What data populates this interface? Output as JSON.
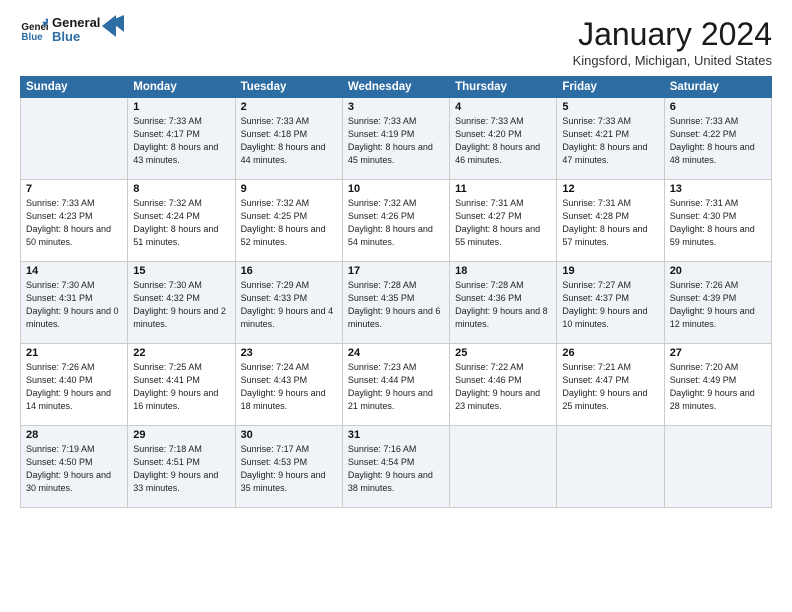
{
  "header": {
    "logo_line1": "General",
    "logo_line2": "Blue",
    "month_title": "January 2024",
    "location": "Kingsford, Michigan, United States"
  },
  "weekdays": [
    "Sunday",
    "Monday",
    "Tuesday",
    "Wednesday",
    "Thursday",
    "Friday",
    "Saturday"
  ],
  "weeks": [
    [
      {
        "day": "",
        "sunrise": "",
        "sunset": "",
        "daylight": ""
      },
      {
        "day": "1",
        "sunrise": "Sunrise: 7:33 AM",
        "sunset": "Sunset: 4:17 PM",
        "daylight": "Daylight: 8 hours and 43 minutes."
      },
      {
        "day": "2",
        "sunrise": "Sunrise: 7:33 AM",
        "sunset": "Sunset: 4:18 PM",
        "daylight": "Daylight: 8 hours and 44 minutes."
      },
      {
        "day": "3",
        "sunrise": "Sunrise: 7:33 AM",
        "sunset": "Sunset: 4:19 PM",
        "daylight": "Daylight: 8 hours and 45 minutes."
      },
      {
        "day": "4",
        "sunrise": "Sunrise: 7:33 AM",
        "sunset": "Sunset: 4:20 PM",
        "daylight": "Daylight: 8 hours and 46 minutes."
      },
      {
        "day": "5",
        "sunrise": "Sunrise: 7:33 AM",
        "sunset": "Sunset: 4:21 PM",
        "daylight": "Daylight: 8 hours and 47 minutes."
      },
      {
        "day": "6",
        "sunrise": "Sunrise: 7:33 AM",
        "sunset": "Sunset: 4:22 PM",
        "daylight": "Daylight: 8 hours and 48 minutes."
      }
    ],
    [
      {
        "day": "7",
        "sunrise": "Sunrise: 7:33 AM",
        "sunset": "Sunset: 4:23 PM",
        "daylight": "Daylight: 8 hours and 50 minutes."
      },
      {
        "day": "8",
        "sunrise": "Sunrise: 7:32 AM",
        "sunset": "Sunset: 4:24 PM",
        "daylight": "Daylight: 8 hours and 51 minutes."
      },
      {
        "day": "9",
        "sunrise": "Sunrise: 7:32 AM",
        "sunset": "Sunset: 4:25 PM",
        "daylight": "Daylight: 8 hours and 52 minutes."
      },
      {
        "day": "10",
        "sunrise": "Sunrise: 7:32 AM",
        "sunset": "Sunset: 4:26 PM",
        "daylight": "Daylight: 8 hours and 54 minutes."
      },
      {
        "day": "11",
        "sunrise": "Sunrise: 7:31 AM",
        "sunset": "Sunset: 4:27 PM",
        "daylight": "Daylight: 8 hours and 55 minutes."
      },
      {
        "day": "12",
        "sunrise": "Sunrise: 7:31 AM",
        "sunset": "Sunset: 4:28 PM",
        "daylight": "Daylight: 8 hours and 57 minutes."
      },
      {
        "day": "13",
        "sunrise": "Sunrise: 7:31 AM",
        "sunset": "Sunset: 4:30 PM",
        "daylight": "Daylight: 8 hours and 59 minutes."
      }
    ],
    [
      {
        "day": "14",
        "sunrise": "Sunrise: 7:30 AM",
        "sunset": "Sunset: 4:31 PM",
        "daylight": "Daylight: 9 hours and 0 minutes."
      },
      {
        "day": "15",
        "sunrise": "Sunrise: 7:30 AM",
        "sunset": "Sunset: 4:32 PM",
        "daylight": "Daylight: 9 hours and 2 minutes."
      },
      {
        "day": "16",
        "sunrise": "Sunrise: 7:29 AM",
        "sunset": "Sunset: 4:33 PM",
        "daylight": "Daylight: 9 hours and 4 minutes."
      },
      {
        "day": "17",
        "sunrise": "Sunrise: 7:28 AM",
        "sunset": "Sunset: 4:35 PM",
        "daylight": "Daylight: 9 hours and 6 minutes."
      },
      {
        "day": "18",
        "sunrise": "Sunrise: 7:28 AM",
        "sunset": "Sunset: 4:36 PM",
        "daylight": "Daylight: 9 hours and 8 minutes."
      },
      {
        "day": "19",
        "sunrise": "Sunrise: 7:27 AM",
        "sunset": "Sunset: 4:37 PM",
        "daylight": "Daylight: 9 hours and 10 minutes."
      },
      {
        "day": "20",
        "sunrise": "Sunrise: 7:26 AM",
        "sunset": "Sunset: 4:39 PM",
        "daylight": "Daylight: 9 hours and 12 minutes."
      }
    ],
    [
      {
        "day": "21",
        "sunrise": "Sunrise: 7:26 AM",
        "sunset": "Sunset: 4:40 PM",
        "daylight": "Daylight: 9 hours and 14 minutes."
      },
      {
        "day": "22",
        "sunrise": "Sunrise: 7:25 AM",
        "sunset": "Sunset: 4:41 PM",
        "daylight": "Daylight: 9 hours and 16 minutes."
      },
      {
        "day": "23",
        "sunrise": "Sunrise: 7:24 AM",
        "sunset": "Sunset: 4:43 PM",
        "daylight": "Daylight: 9 hours and 18 minutes."
      },
      {
        "day": "24",
        "sunrise": "Sunrise: 7:23 AM",
        "sunset": "Sunset: 4:44 PM",
        "daylight": "Daylight: 9 hours and 21 minutes."
      },
      {
        "day": "25",
        "sunrise": "Sunrise: 7:22 AM",
        "sunset": "Sunset: 4:46 PM",
        "daylight": "Daylight: 9 hours and 23 minutes."
      },
      {
        "day": "26",
        "sunrise": "Sunrise: 7:21 AM",
        "sunset": "Sunset: 4:47 PM",
        "daylight": "Daylight: 9 hours and 25 minutes."
      },
      {
        "day": "27",
        "sunrise": "Sunrise: 7:20 AM",
        "sunset": "Sunset: 4:49 PM",
        "daylight": "Daylight: 9 hours and 28 minutes."
      }
    ],
    [
      {
        "day": "28",
        "sunrise": "Sunrise: 7:19 AM",
        "sunset": "Sunset: 4:50 PM",
        "daylight": "Daylight: 9 hours and 30 minutes."
      },
      {
        "day": "29",
        "sunrise": "Sunrise: 7:18 AM",
        "sunset": "Sunset: 4:51 PM",
        "daylight": "Daylight: 9 hours and 33 minutes."
      },
      {
        "day": "30",
        "sunrise": "Sunrise: 7:17 AM",
        "sunset": "Sunset: 4:53 PM",
        "daylight": "Daylight: 9 hours and 35 minutes."
      },
      {
        "day": "31",
        "sunrise": "Sunrise: 7:16 AM",
        "sunset": "Sunset: 4:54 PM",
        "daylight": "Daylight: 9 hours and 38 minutes."
      },
      {
        "day": "",
        "sunrise": "",
        "sunset": "",
        "daylight": ""
      },
      {
        "day": "",
        "sunrise": "",
        "sunset": "",
        "daylight": ""
      },
      {
        "day": "",
        "sunrise": "",
        "sunset": "",
        "daylight": ""
      }
    ]
  ]
}
